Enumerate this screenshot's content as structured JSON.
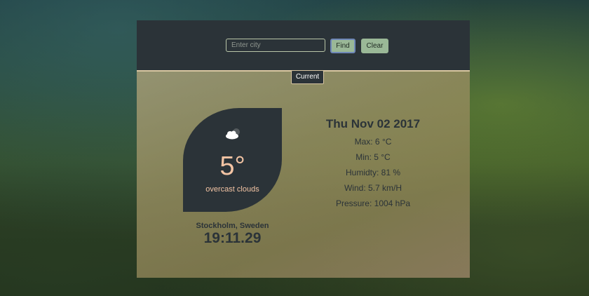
{
  "search": {
    "placeholder": "Enter city",
    "find_label": "Find",
    "clear_label": "Clear"
  },
  "tabs": {
    "current_label": "Current"
  },
  "weather": {
    "icon": "cloud-sun-icon",
    "temperature": "5°",
    "description": "overcast clouds",
    "location": "Stockholm, Sweden",
    "time": "19:11.29"
  },
  "details": {
    "date": "Thu Nov 02 2017",
    "max": "Max: 6 °C",
    "min": "Min: 5 °C",
    "humidity": "Humidty: 81 %",
    "wind": "Wind: 5.7 km/H",
    "pressure": "Pressure: 1004 hPa"
  },
  "colors": {
    "panel_dark": "#2b3338",
    "button_green": "#9ab897",
    "accent_peach": "#f3c4a4",
    "divider": "#d9c7a2"
  }
}
